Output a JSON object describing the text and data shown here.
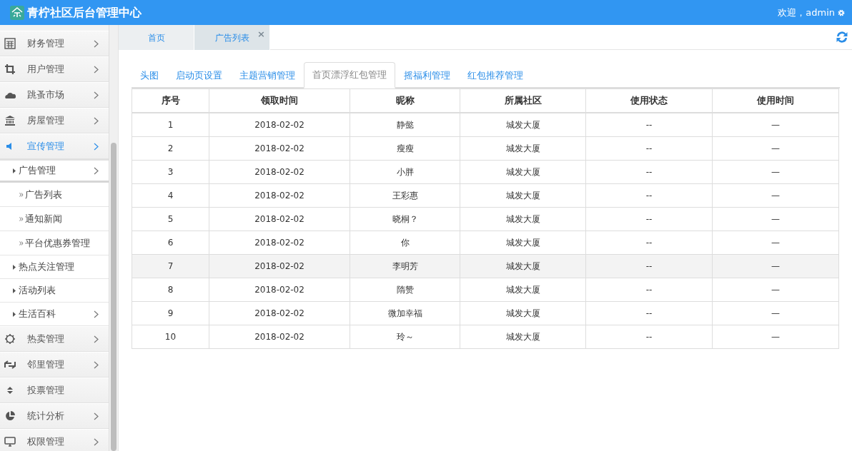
{
  "header": {
    "title": "青柠社区后台管理中心",
    "welcome": "欢迎，admin"
  },
  "sidebar": {
    "items": [
      {
        "label": "财务管理",
        "has_submenu": true,
        "selected": false
      },
      {
        "label": "用户管理",
        "has_submenu": true,
        "selected": false
      },
      {
        "label": "跳蚤市场",
        "has_submenu": true,
        "selected": false
      },
      {
        "label": "房屋管理",
        "has_submenu": true,
        "selected": false
      },
      {
        "label": "宣传管理",
        "has_submenu": true,
        "selected": true,
        "expanded": true,
        "children": [
          {
            "label": "广告管理",
            "has_submenu": true,
            "expanded": true,
            "children": [
              {
                "label": "广告列表"
              },
              {
                "label": "通知新闻"
              },
              {
                "label": "平台优惠券管理"
              }
            ]
          },
          {
            "label": "热点关注管理",
            "has_submenu": false
          },
          {
            "label": "活动列表",
            "has_submenu": false
          },
          {
            "label": "生活百科",
            "has_submenu": true
          }
        ]
      },
      {
        "label": "热卖管理",
        "has_submenu": true,
        "selected": false
      },
      {
        "label": "邻里管理",
        "has_submenu": true,
        "selected": false
      },
      {
        "label": "投票管理",
        "has_submenu": false,
        "selected": false
      },
      {
        "label": "统计分析",
        "has_submenu": true,
        "selected": false
      },
      {
        "label": "权限管理",
        "has_submenu": true,
        "selected": false
      }
    ]
  },
  "page_tabs": [
    {
      "label": "首页",
      "selected": false,
      "closable": false
    },
    {
      "label": "广告列表",
      "selected": true,
      "closable": true
    }
  ],
  "close_glyph": "×",
  "tabs": [
    {
      "label": "头图",
      "selected": false
    },
    {
      "label": "启动页设置",
      "selected": false
    },
    {
      "label": "主题营销管理",
      "selected": false
    },
    {
      "label": "首页漂浮红包管理",
      "selected": true
    },
    {
      "label": "摇福利管理",
      "selected": false
    },
    {
      "label": "红包推荐管理",
      "selected": false
    }
  ],
  "table": {
    "columns": [
      "序号",
      "领取时间",
      "昵称",
      "所属社区",
      "使用状态",
      "使用时间"
    ],
    "rows": [
      {
        "cells": [
          "1",
          "2018-02-02",
          "静懿",
          "城发大厦",
          "--",
          "—"
        ],
        "selected": false
      },
      {
        "cells": [
          "2",
          "2018-02-02",
          "瘦瘦",
          "城发大厦",
          "--",
          "—"
        ],
        "selected": false
      },
      {
        "cells": [
          "3",
          "2018-02-02",
          "小胖",
          "城发大厦",
          "--",
          "—"
        ],
        "selected": false
      },
      {
        "cells": [
          "4",
          "2018-02-02",
          "王彩惠",
          "城发大厦",
          "--",
          "—"
        ],
        "selected": false
      },
      {
        "cells": [
          "5",
          "2018-02-02",
          "晓桐？",
          "城发大厦",
          "--",
          "—"
        ],
        "selected": false
      },
      {
        "cells": [
          "6",
          "2018-02-02",
          "你",
          "城发大厦",
          "--",
          "—"
        ],
        "selected": false
      },
      {
        "cells": [
          "7",
          "2018-02-02",
          "李明芳",
          "城发大厦",
          "--",
          "—"
        ],
        "selected": true
      },
      {
        "cells": [
          "8",
          "2018-02-02",
          "隋赞",
          "城发大厦",
          "--",
          "—"
        ],
        "selected": false
      },
      {
        "cells": [
          "9",
          "2018-02-02",
          "微加幸福",
          "城发大厦",
          "--",
          "—"
        ],
        "selected": false
      },
      {
        "cells": [
          "10",
          "2018-02-02",
          "玲～",
          "城发大厦",
          "--",
          "—"
        ],
        "selected": false
      }
    ]
  }
}
